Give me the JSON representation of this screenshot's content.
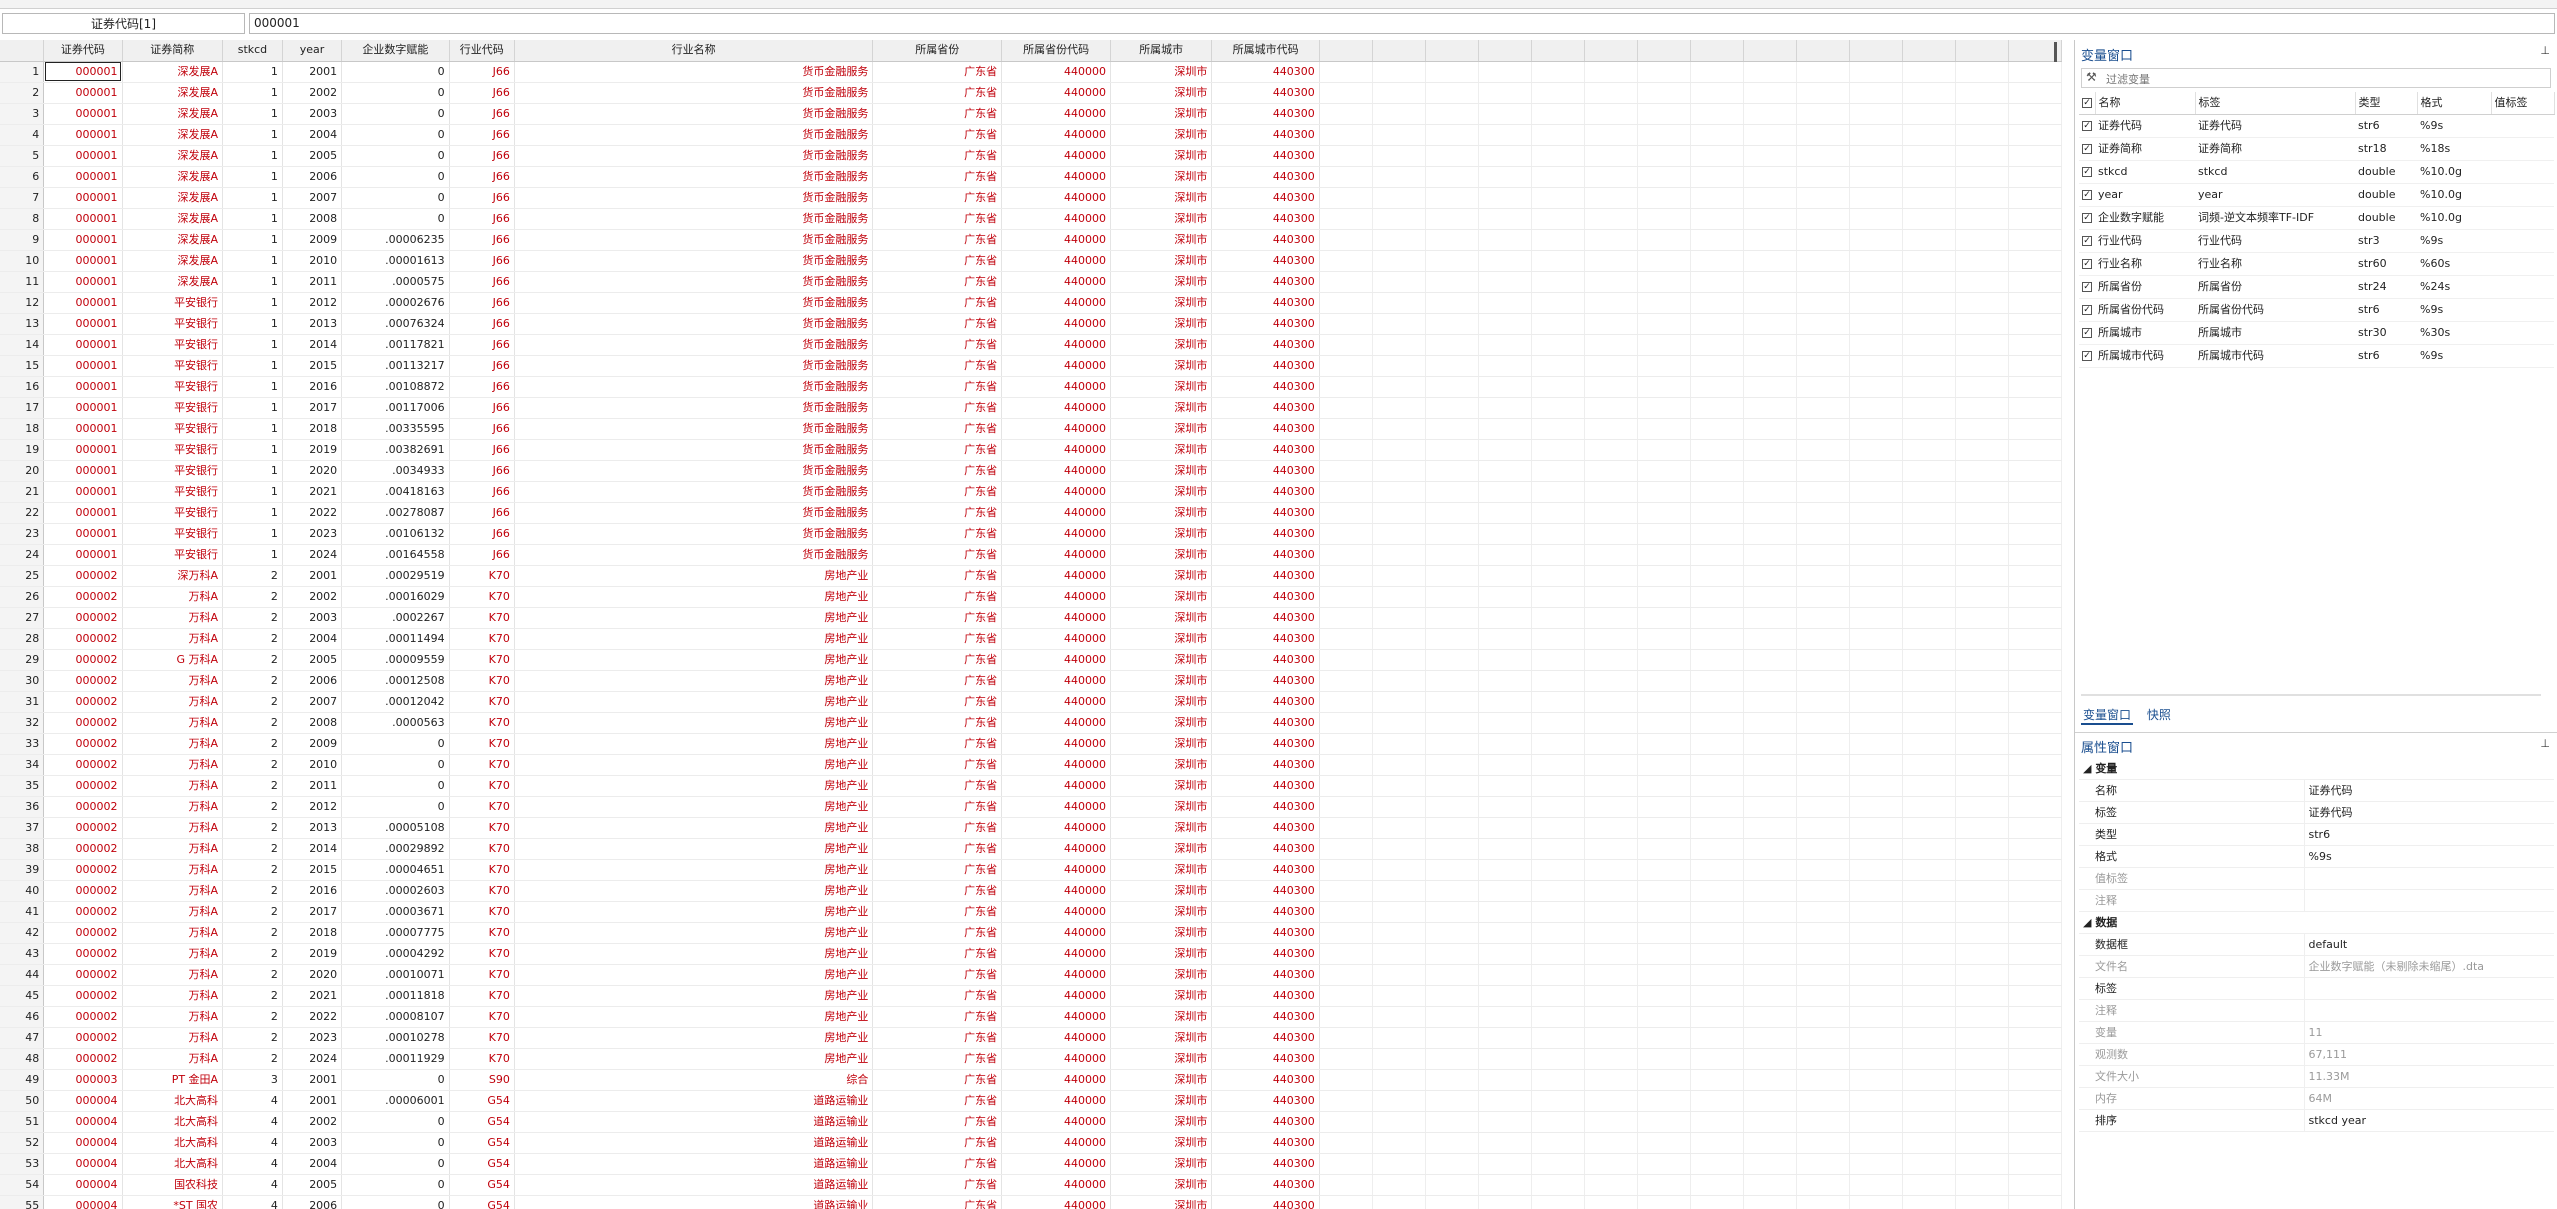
{
  "cell_reference": "证券代码[1]",
  "cell_value": "000001",
  "columns": [
    "证券代码",
    "证券简称",
    "stkcd",
    "year",
    "企业数字赋能",
    "行业代码",
    "行业名称",
    "所属省份",
    "所属省份代码",
    "所属城市",
    "所属城市代码"
  ],
  "rows": [
    [
      "1",
      "000001",
      "深发展A",
      "1",
      "2001",
      "0",
      "J66",
      "货币金融服务",
      "广东省",
      "440000",
      "深圳市",
      "440300"
    ],
    [
      "2",
      "000001",
      "深发展A",
      "1",
      "2002",
      "0",
      "J66",
      "货币金融服务",
      "广东省",
      "440000",
      "深圳市",
      "440300"
    ],
    [
      "3",
      "000001",
      "深发展A",
      "1",
      "2003",
      "0",
      "J66",
      "货币金融服务",
      "广东省",
      "440000",
      "深圳市",
      "440300"
    ],
    [
      "4",
      "000001",
      "深发展A",
      "1",
      "2004",
      "0",
      "J66",
      "货币金融服务",
      "广东省",
      "440000",
      "深圳市",
      "440300"
    ],
    [
      "5",
      "000001",
      "深发展A",
      "1",
      "2005",
      "0",
      "J66",
      "货币金融服务",
      "广东省",
      "440000",
      "深圳市",
      "440300"
    ],
    [
      "6",
      "000001",
      "深发展A",
      "1",
      "2006",
      "0",
      "J66",
      "货币金融服务",
      "广东省",
      "440000",
      "深圳市",
      "440300"
    ],
    [
      "7",
      "000001",
      "深发展A",
      "1",
      "2007",
      "0",
      "J66",
      "货币金融服务",
      "广东省",
      "440000",
      "深圳市",
      "440300"
    ],
    [
      "8",
      "000001",
      "深发展A",
      "1",
      "2008",
      "0",
      "J66",
      "货币金融服务",
      "广东省",
      "440000",
      "深圳市",
      "440300"
    ],
    [
      "9",
      "000001",
      "深发展A",
      "1",
      "2009",
      ".00006235",
      "J66",
      "货币金融服务",
      "广东省",
      "440000",
      "深圳市",
      "440300"
    ],
    [
      "10",
      "000001",
      "深发展A",
      "1",
      "2010",
      ".00001613",
      "J66",
      "货币金融服务",
      "广东省",
      "440000",
      "深圳市",
      "440300"
    ],
    [
      "11",
      "000001",
      "深发展A",
      "1",
      "2011",
      ".0000575",
      "J66",
      "货币金融服务",
      "广东省",
      "440000",
      "深圳市",
      "440300"
    ],
    [
      "12",
      "000001",
      "平安银行",
      "1",
      "2012",
      ".00002676",
      "J66",
      "货币金融服务",
      "广东省",
      "440000",
      "深圳市",
      "440300"
    ],
    [
      "13",
      "000001",
      "平安银行",
      "1",
      "2013",
      ".00076324",
      "J66",
      "货币金融服务",
      "广东省",
      "440000",
      "深圳市",
      "440300"
    ],
    [
      "14",
      "000001",
      "平安银行",
      "1",
      "2014",
      ".00117821",
      "J66",
      "货币金融服务",
      "广东省",
      "440000",
      "深圳市",
      "440300"
    ],
    [
      "15",
      "000001",
      "平安银行",
      "1",
      "2015",
      ".00113217",
      "J66",
      "货币金融服务",
      "广东省",
      "440000",
      "深圳市",
      "440300"
    ],
    [
      "16",
      "000001",
      "平安银行",
      "1",
      "2016",
      ".00108872",
      "J66",
      "货币金融服务",
      "广东省",
      "440000",
      "深圳市",
      "440300"
    ],
    [
      "17",
      "000001",
      "平安银行",
      "1",
      "2017",
      ".00117006",
      "J66",
      "货币金融服务",
      "广东省",
      "440000",
      "深圳市",
      "440300"
    ],
    [
      "18",
      "000001",
      "平安银行",
      "1",
      "2018",
      ".00335595",
      "J66",
      "货币金融服务",
      "广东省",
      "440000",
      "深圳市",
      "440300"
    ],
    [
      "19",
      "000001",
      "平安银行",
      "1",
      "2019",
      ".00382691",
      "J66",
      "货币金融服务",
      "广东省",
      "440000",
      "深圳市",
      "440300"
    ],
    [
      "20",
      "000001",
      "平安银行",
      "1",
      "2020",
      ".0034933",
      "J66",
      "货币金融服务",
      "广东省",
      "440000",
      "深圳市",
      "440300"
    ],
    [
      "21",
      "000001",
      "平安银行",
      "1",
      "2021",
      ".00418163",
      "J66",
      "货币金融服务",
      "广东省",
      "440000",
      "深圳市",
      "440300"
    ],
    [
      "22",
      "000001",
      "平安银行",
      "1",
      "2022",
      ".00278087",
      "J66",
      "货币金融服务",
      "广东省",
      "440000",
      "深圳市",
      "440300"
    ],
    [
      "23",
      "000001",
      "平安银行",
      "1",
      "2023",
      ".00106132",
      "J66",
      "货币金融服务",
      "广东省",
      "440000",
      "深圳市",
      "440300"
    ],
    [
      "24",
      "000001",
      "平安银行",
      "1",
      "2024",
      ".00164558",
      "J66",
      "货币金融服务",
      "广东省",
      "440000",
      "深圳市",
      "440300"
    ],
    [
      "25",
      "000002",
      "深万科A",
      "2",
      "2001",
      ".00029519",
      "K70",
      "房地产业",
      "广东省",
      "440000",
      "深圳市",
      "440300"
    ],
    [
      "26",
      "000002",
      "万科A",
      "2",
      "2002",
      ".00016029",
      "K70",
      "房地产业",
      "广东省",
      "440000",
      "深圳市",
      "440300"
    ],
    [
      "27",
      "000002",
      "万科A",
      "2",
      "2003",
      ".0002267",
      "K70",
      "房地产业",
      "广东省",
      "440000",
      "深圳市",
      "440300"
    ],
    [
      "28",
      "000002",
      "万科A",
      "2",
      "2004",
      ".00011494",
      "K70",
      "房地产业",
      "广东省",
      "440000",
      "深圳市",
      "440300"
    ],
    [
      "29",
      "000002",
      "G 万科A",
      "2",
      "2005",
      ".00009559",
      "K70",
      "房地产业",
      "广东省",
      "440000",
      "深圳市",
      "440300"
    ],
    [
      "30",
      "000002",
      "万科A",
      "2",
      "2006",
      ".00012508",
      "K70",
      "房地产业",
      "广东省",
      "440000",
      "深圳市",
      "440300"
    ],
    [
      "31",
      "000002",
      "万科A",
      "2",
      "2007",
      ".00012042",
      "K70",
      "房地产业",
      "广东省",
      "440000",
      "深圳市",
      "440300"
    ],
    [
      "32",
      "000002",
      "万科A",
      "2",
      "2008",
      ".0000563",
      "K70",
      "房地产业",
      "广东省",
      "440000",
      "深圳市",
      "440300"
    ],
    [
      "33",
      "000002",
      "万科A",
      "2",
      "2009",
      "0",
      "K70",
      "房地产业",
      "广东省",
      "440000",
      "深圳市",
      "440300"
    ],
    [
      "34",
      "000002",
      "万科A",
      "2",
      "2010",
      "0",
      "K70",
      "房地产业",
      "广东省",
      "440000",
      "深圳市",
      "440300"
    ],
    [
      "35",
      "000002",
      "万科A",
      "2",
      "2011",
      "0",
      "K70",
      "房地产业",
      "广东省",
      "440000",
      "深圳市",
      "440300"
    ],
    [
      "36",
      "000002",
      "万科A",
      "2",
      "2012",
      "0",
      "K70",
      "房地产业",
      "广东省",
      "440000",
      "深圳市",
      "440300"
    ],
    [
      "37",
      "000002",
      "万科A",
      "2",
      "2013",
      ".00005108",
      "K70",
      "房地产业",
      "广东省",
      "440000",
      "深圳市",
      "440300"
    ],
    [
      "38",
      "000002",
      "万科A",
      "2",
      "2014",
      ".00029892",
      "K70",
      "房地产业",
      "广东省",
      "440000",
      "深圳市",
      "440300"
    ],
    [
      "39",
      "000002",
      "万科A",
      "2",
      "2015",
      ".00004651",
      "K70",
      "房地产业",
      "广东省",
      "440000",
      "深圳市",
      "440300"
    ],
    [
      "40",
      "000002",
      "万科A",
      "2",
      "2016",
      ".00002603",
      "K70",
      "房地产业",
      "广东省",
      "440000",
      "深圳市",
      "440300"
    ],
    [
      "41",
      "000002",
      "万科A",
      "2",
      "2017",
      ".00003671",
      "K70",
      "房地产业",
      "广东省",
      "440000",
      "深圳市",
      "440300"
    ],
    [
      "42",
      "000002",
      "万科A",
      "2",
      "2018",
      ".00007775",
      "K70",
      "房地产业",
      "广东省",
      "440000",
      "深圳市",
      "440300"
    ],
    [
      "43",
      "000002",
      "万科A",
      "2",
      "2019",
      ".00004292",
      "K70",
      "房地产业",
      "广东省",
      "440000",
      "深圳市",
      "440300"
    ],
    [
      "44",
      "000002",
      "万科A",
      "2",
      "2020",
      ".00010071",
      "K70",
      "房地产业",
      "广东省",
      "440000",
      "深圳市",
      "440300"
    ],
    [
      "45",
      "000002",
      "万科A",
      "2",
      "2021",
      ".00011818",
      "K70",
      "房地产业",
      "广东省",
      "440000",
      "深圳市",
      "440300"
    ],
    [
      "46",
      "000002",
      "万科A",
      "2",
      "2022",
      ".00008107",
      "K70",
      "房地产业",
      "广东省",
      "440000",
      "深圳市",
      "440300"
    ],
    [
      "47",
      "000002",
      "万科A",
      "2",
      "2023",
      ".00010278",
      "K70",
      "房地产业",
      "广东省",
      "440000",
      "深圳市",
      "440300"
    ],
    [
      "48",
      "000002",
      "万科A",
      "2",
      "2024",
      ".00011929",
      "K70",
      "房地产业",
      "广东省",
      "440000",
      "深圳市",
      "440300"
    ],
    [
      "49",
      "000003",
      "PT 金田A",
      "3",
      "2001",
      "0",
      "S90",
      "综合",
      "广东省",
      "440000",
      "深圳市",
      "440300"
    ],
    [
      "50",
      "000004",
      "北大高科",
      "4",
      "2001",
      ".00006001",
      "G54",
      "道路运输业",
      "广东省",
      "440000",
      "深圳市",
      "440300"
    ],
    [
      "51",
      "000004",
      "北大高科",
      "4",
      "2002",
      "0",
      "G54",
      "道路运输业",
      "广东省",
      "440000",
      "深圳市",
      "440300"
    ],
    [
      "52",
      "000004",
      "北大高科",
      "4",
      "2003",
      "0",
      "G54",
      "道路运输业",
      "广东省",
      "440000",
      "深圳市",
      "440300"
    ],
    [
      "53",
      "000004",
      "北大高科",
      "4",
      "2004",
      "0",
      "G54",
      "道路运输业",
      "广东省",
      "440000",
      "深圳市",
      "440300"
    ],
    [
      "54",
      "000004",
      "国农科技",
      "4",
      "2005",
      "0",
      "G54",
      "道路运输业",
      "广东省",
      "440000",
      "深圳市",
      "440300"
    ],
    [
      "55",
      "000004",
      "*ST 国农",
      "4",
      "2006",
      "0",
      "G54",
      "道路运输业",
      "广东省",
      "440000",
      "深圳市",
      "440300"
    ]
  ],
  "variable_window": {
    "title": "变量窗口",
    "pin_glyph": "⊥",
    "filter_placeholder": "过滤变量",
    "headers": [
      "名称",
      "标签",
      "类型",
      "格式",
      "值标签"
    ],
    "variables": [
      {
        "name": "证券代码",
        "label": "证券代码",
        "type": "str6",
        "format": "%9s"
      },
      {
        "name": "证券简称",
        "label": "证券简称",
        "type": "str18",
        "format": "%18s"
      },
      {
        "name": "stkcd",
        "label": "stkcd",
        "type": "double",
        "format": "%10.0g"
      },
      {
        "name": "year",
        "label": "year",
        "type": "double",
        "format": "%10.0g"
      },
      {
        "name": "企业数字赋能",
        "label": "词频-逆文本频率TF-IDF",
        "type": "double",
        "format": "%10.0g"
      },
      {
        "name": "行业代码",
        "label": "行业代码",
        "type": "str3",
        "format": "%9s"
      },
      {
        "name": "行业名称",
        "label": "行业名称",
        "type": "str60",
        "format": "%60s"
      },
      {
        "name": "所属省份",
        "label": "所属省份",
        "type": "str24",
        "format": "%24s"
      },
      {
        "name": "所属省份代码",
        "label": "所属省份代码",
        "type": "str6",
        "format": "%9s"
      },
      {
        "name": "所属城市",
        "label": "所属城市",
        "type": "str30",
        "format": "%30s"
      },
      {
        "name": "所属城市代码",
        "label": "所属城市代码",
        "type": "str6",
        "format": "%9s"
      }
    ],
    "tabs": [
      "变量窗口",
      "快照"
    ]
  },
  "properties_window": {
    "title": "属性窗口",
    "sections": [
      {
        "name": "变量",
        "rows": [
          {
            "k": "名称",
            "v": "证券代码",
            "dim": false
          },
          {
            "k": "标签",
            "v": "证券代码",
            "dim": false
          },
          {
            "k": "类型",
            "v": "str6",
            "dim": false
          },
          {
            "k": "格式",
            "v": "%9s",
            "dim": false
          },
          {
            "k": "值标签",
            "v": "",
            "dim": true
          },
          {
            "k": "注释",
            "v": "",
            "dim": true
          }
        ]
      },
      {
        "name": "数据",
        "rows": [
          {
            "k": "数据框",
            "v": "default",
            "dim": false
          },
          {
            "k": "文件名",
            "v": "企业数字赋能（未剔除未缩尾）.dta",
            "dim": true
          },
          {
            "k": "标签",
            "v": "",
            "dim": false
          },
          {
            "k": "注释",
            "v": "",
            "dim": true
          },
          {
            "k": "变量",
            "v": "11",
            "dim": true
          },
          {
            "k": "观测数",
            "v": "67,111",
            "dim": true
          },
          {
            "k": "文件大小",
            "v": "11.33M",
            "dim": true
          },
          {
            "k": "内存",
            "v": "64M",
            "dim": true
          },
          {
            "k": "排序",
            "v": "stkcd year",
            "dim": false
          }
        ]
      }
    ]
  }
}
